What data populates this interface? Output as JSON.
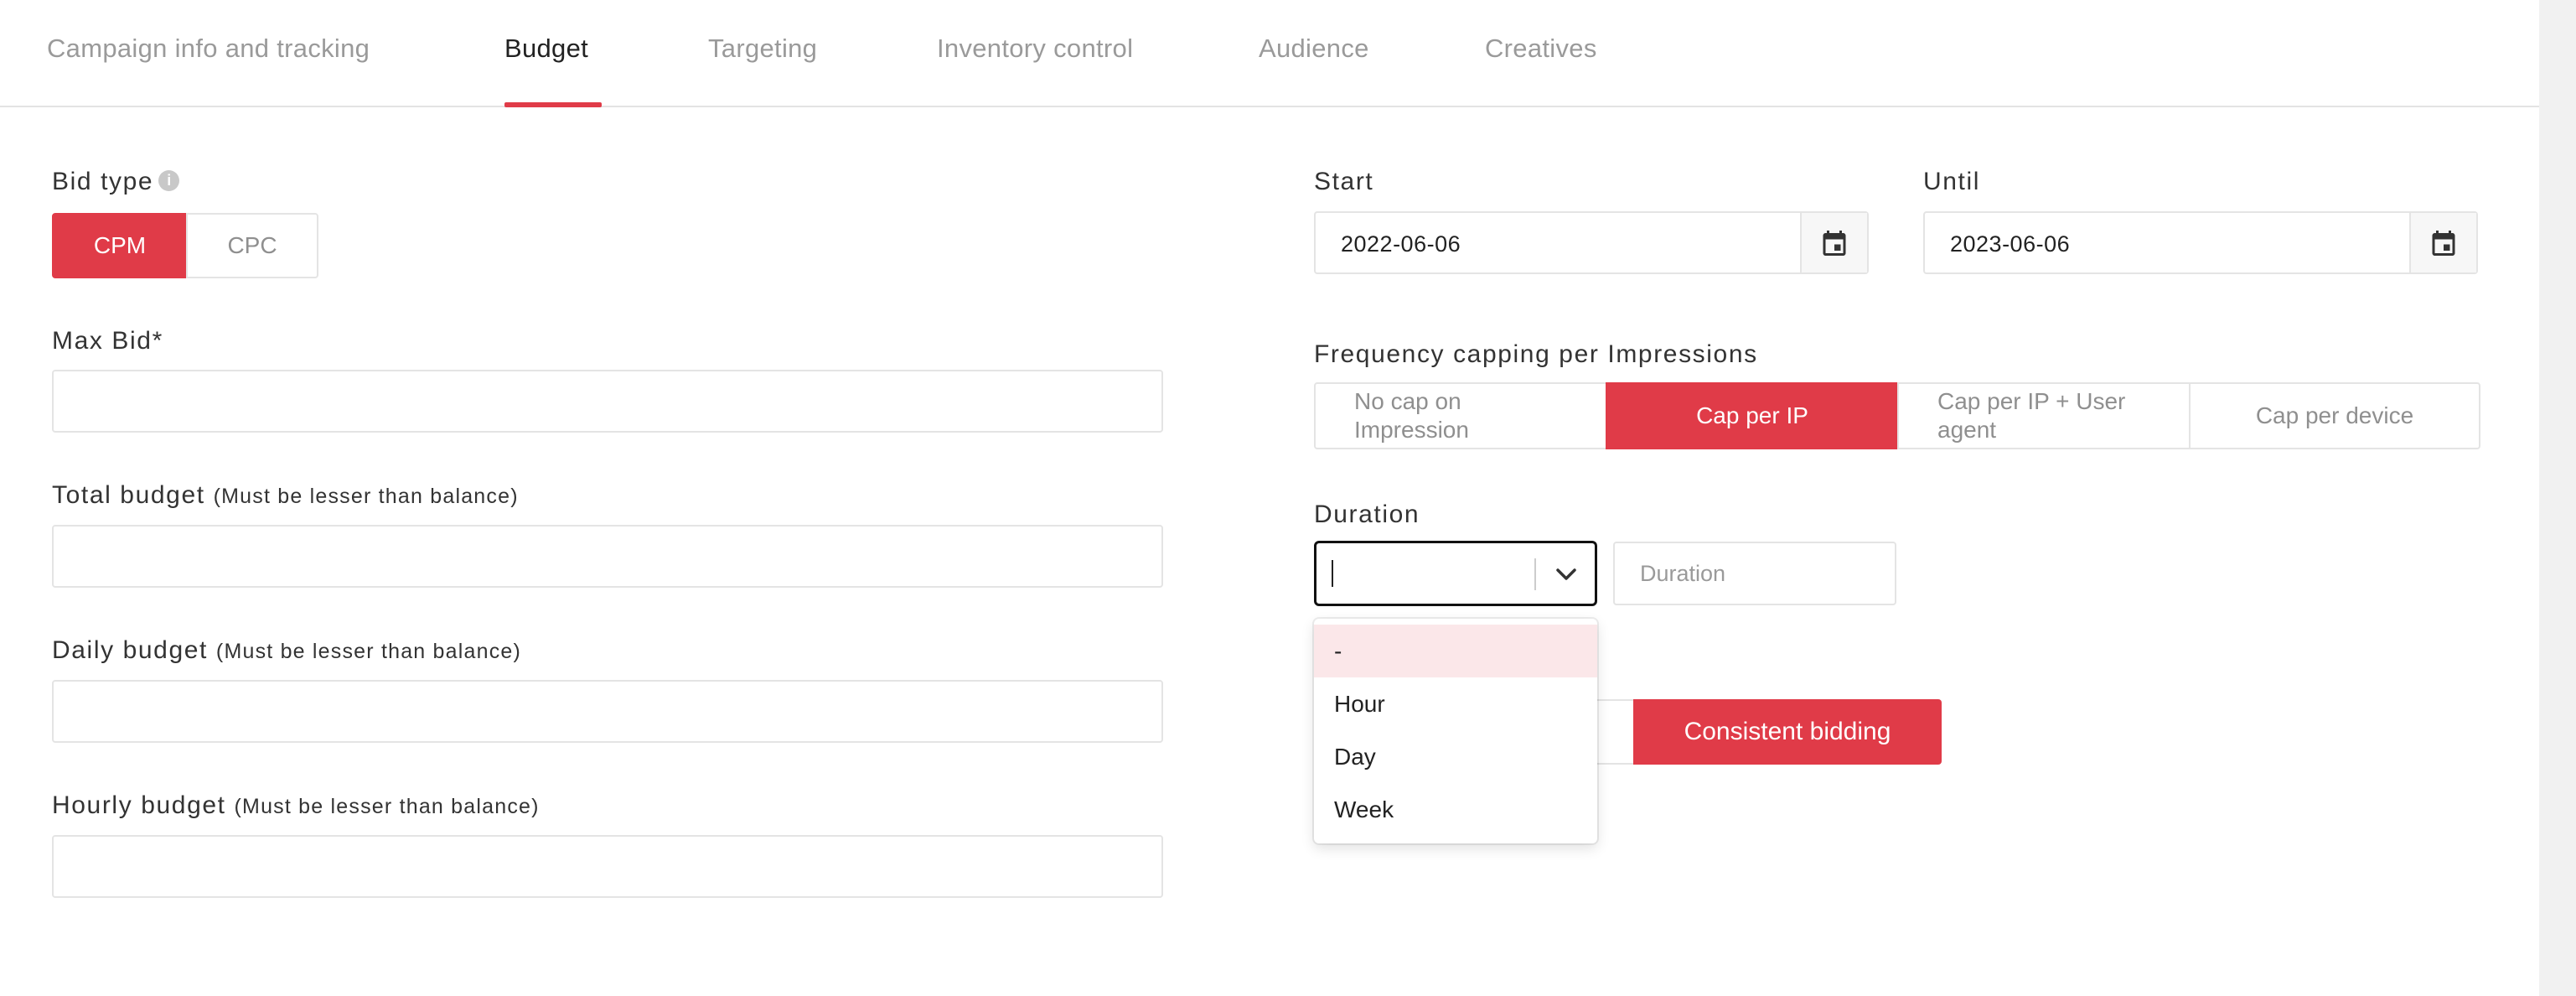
{
  "tabs": [
    {
      "label": "Campaign info and tracking",
      "active": false
    },
    {
      "label": "Budget",
      "active": true
    },
    {
      "label": "Targeting",
      "active": false
    },
    {
      "label": "Inventory control",
      "active": false
    },
    {
      "label": "Audience",
      "active": false
    },
    {
      "label": "Creatives",
      "active": false
    }
  ],
  "bid_type": {
    "label": "Bid type",
    "info_icon": "info-icon",
    "options": [
      "CPM",
      "CPC"
    ],
    "selected": "CPM"
  },
  "max_bid": {
    "label": "Max Bid*",
    "value": ""
  },
  "total_budget": {
    "label": "Total budget",
    "hint": "(Must be lesser than balance)",
    "value": ""
  },
  "daily_budget": {
    "label": "Daily budget",
    "hint": "(Must be lesser than balance)",
    "value": ""
  },
  "hourly_budget": {
    "label": "Hourly budget",
    "hint": "(Must be lesser than balance)",
    "value": ""
  },
  "start": {
    "label": "Start",
    "value": "2022-06-06",
    "icon": "calendar-icon"
  },
  "until": {
    "label": "Until",
    "value": "2023-06-06",
    "icon": "calendar-icon"
  },
  "frequency_capping": {
    "label": "Frequency capping per Impressions",
    "options": [
      "No cap on Impression",
      "Cap per IP",
      "Cap per IP + User agent",
      "Cap per device"
    ],
    "option_lines": [
      [
        "No cap on",
        "Impression"
      ],
      [
        "Cap per IP"
      ],
      [
        "Cap per IP + User",
        "agent"
      ],
      [
        "Cap per device"
      ]
    ],
    "selected": "Cap per IP"
  },
  "duration": {
    "label": "Duration",
    "select_value": "",
    "input_placeholder": "Duration",
    "input_value": "",
    "dropdown_open": true,
    "options": [
      "-",
      "Hour",
      "Day",
      "Week"
    ],
    "highlighted": "-"
  },
  "bidding": {
    "selected_label": "Consistent bidding"
  },
  "colors": {
    "accent": "#e03b48",
    "highlight": "#fbe7e9",
    "border": "#e4e4e4",
    "muted_text": "#9a9a9a"
  }
}
